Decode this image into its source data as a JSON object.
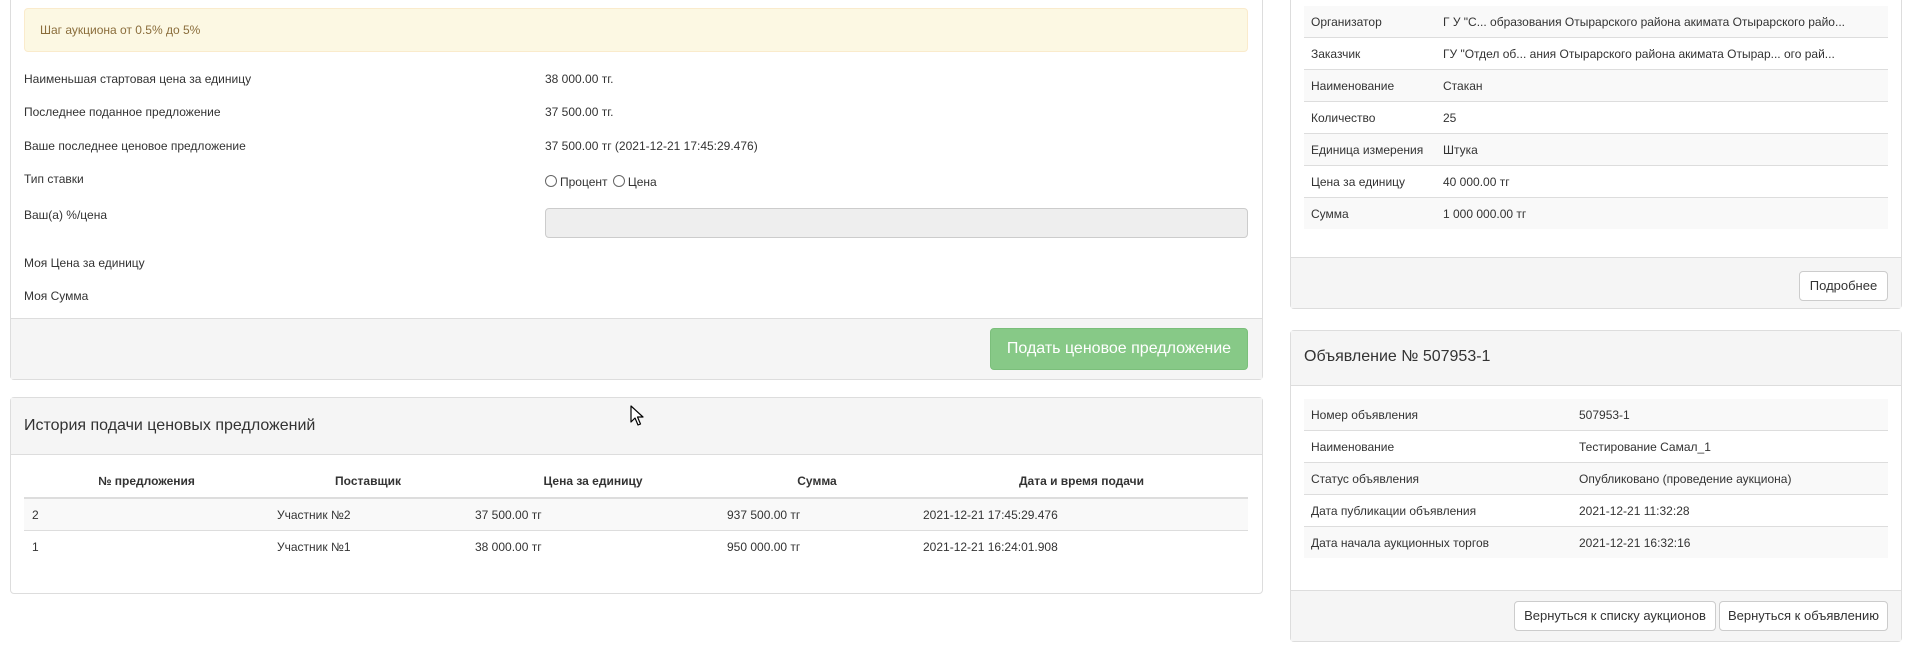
{
  "alert": {
    "text": "Шаг аукциона от 0.5% до 5%"
  },
  "bid_form": {
    "rows": [
      {
        "label": "Наименьшая стартовая цена за единицу",
        "value": "38 000.00 тг."
      },
      {
        "label": "Последнее поданное предложение",
        "value": "37 500.00 тг."
      },
      {
        "label": "Ваше последнее ценовое предложение",
        "value": "37 500.00 тг (2021-12-21 17:45:29.476)"
      }
    ],
    "rate_type_label": "Тип ставки",
    "rate_options": [
      "Процент",
      "Цена"
    ],
    "your_value_label": "Ваш(а) %/цена",
    "my_unit_price_label": "Моя Цена за единицу",
    "my_sum_label": "Моя Сумма",
    "submit_label": "Подать ценовое предложение"
  },
  "history": {
    "title": "История подачи ценовых предложений",
    "columns": [
      "№ предложения",
      "Поставщик",
      "Цена за единицу",
      "Сумма",
      "Дата и время подачи"
    ],
    "rows": [
      [
        "2",
        "Участник №2",
        "37 500.00 тг",
        "937 500.00 тг",
        "2021-12-21 17:45:29.476"
      ],
      [
        "1",
        "Участник №1",
        "38 000.00 тг",
        "950 000.00 тг",
        "2021-12-21 16:24:01.908"
      ]
    ]
  },
  "lot_info": {
    "rows": [
      [
        "Организатор",
        "Г У \"С... образования Отырарского района акимата Отырарского райо..."
      ],
      [
        "Заказчик",
        "ГУ \"Отдел об... ания Отырарского района акимата Отырар... ого рай..."
      ],
      [
        "Наименование",
        "Стакан"
      ],
      [
        "Количество",
        "25"
      ],
      [
        "Единица измерения",
        "Штука"
      ],
      [
        "Цена за единицу",
        "40 000.00 тг"
      ],
      [
        "Сумма",
        "1 000 000.00 тг"
      ]
    ],
    "more_label": "Подробнее"
  },
  "announcement": {
    "title": "Объявление № 507953-1",
    "rows": [
      [
        "Номер объявления",
        "507953-1"
      ],
      [
        "Наименование",
        "Тестирование Самал_1"
      ],
      [
        "Статус объявления",
        "Опубликовано (проведение аукциона)"
      ],
      [
        "Дата публикации объявления",
        "2021-12-21 11:32:28"
      ],
      [
        "Дата начала аукционных торгов",
        "2021-12-21 16:32:16"
      ]
    ],
    "back_to_list_label": "Вернуться к списку аукционов",
    "back_to_announcement_label": "Вернуться к объявлению"
  }
}
